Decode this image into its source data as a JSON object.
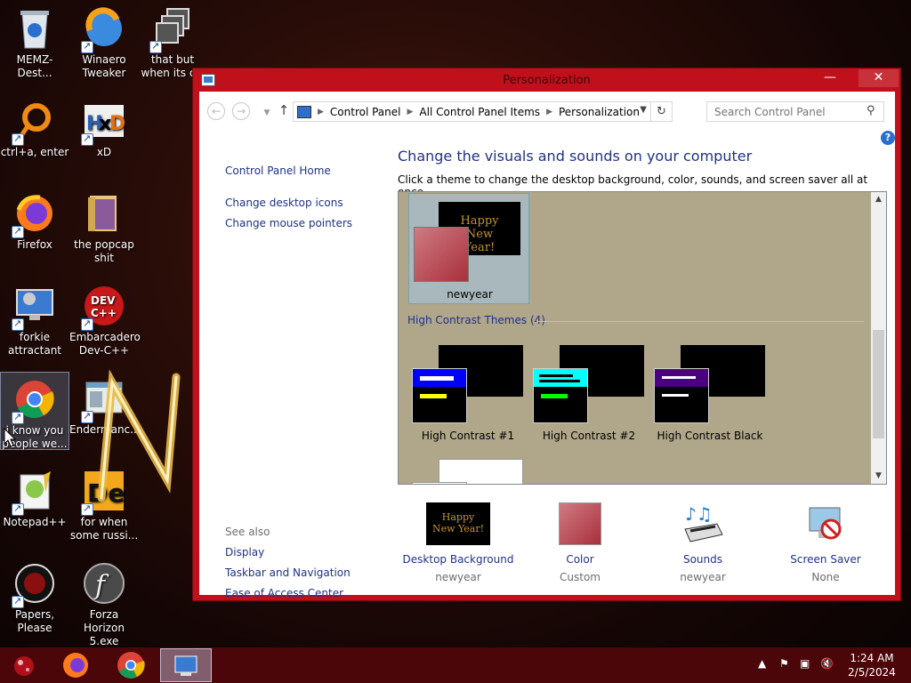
{
  "desktop": {
    "icons": [
      {
        "label": "MEMZ-Dest..."
      },
      {
        "label": "Winaero Tweaker"
      },
      {
        "label": "that but when its c#"
      },
      {
        "label": "ctrl+a, enter"
      },
      {
        "label": "xD"
      },
      {
        "label": "Firefox"
      },
      {
        "label": "the popcap shit"
      },
      {
        "label": "forkie attractant"
      },
      {
        "label": "Embarcadero Dev-C++"
      },
      {
        "label": "i know you people we..."
      },
      {
        "label": "Endermanc..."
      },
      {
        "label": "Notepad++"
      },
      {
        "label": "for when some russi..."
      },
      {
        "label": "Papers, Please"
      },
      {
        "label": "Forza Horizon 5.exe"
      }
    ]
  },
  "window": {
    "title": "Personalization",
    "minimize": "—",
    "maximize": "☐",
    "close": "✕",
    "address": {
      "segments": [
        "Control Panel",
        "All Control Panel Items",
        "Personalization"
      ]
    },
    "search_placeholder": "Search Control Panel",
    "left_pane": {
      "home": "Control Panel Home",
      "links": [
        "Change desktop icons",
        "Change mouse pointers"
      ],
      "see_also": "See also",
      "see_also_links": [
        "Display",
        "Taskbar and Navigation",
        "Ease of Access Center"
      ]
    },
    "heading": "Change the visuals and sounds on your computer",
    "subheading": "Click a theme to change the desktop background, color, sounds, and screen saver all at once.",
    "themes": {
      "selected": {
        "name": "newyear",
        "preview_text": "Happy New Year!"
      },
      "group_header": "High Contrast Themes (4)",
      "high_contrast": [
        {
          "name": "High Contrast #1",
          "colors": {
            "title": "#0000ff",
            "line1": "#ffffff",
            "line2": "#ffff00"
          }
        },
        {
          "name": "High Contrast #2",
          "colors": {
            "title": "#00ffff",
            "line1": "#000000",
            "line2": "#00ff00"
          }
        },
        {
          "name": "High Contrast Black",
          "colors": {
            "title": "#4b0082",
            "line1": "#ffffff",
            "line2": "#ffffff"
          }
        }
      ]
    },
    "bottom": [
      {
        "label": "Desktop Background",
        "value": "newyear"
      },
      {
        "label": "Color",
        "value": "Custom"
      },
      {
        "label": "Sounds",
        "value": "newyear"
      },
      {
        "label": "Screen Saver",
        "value": "None"
      }
    ]
  },
  "taskbar": {
    "time": "1:24 AM",
    "date": "2/5/2024"
  },
  "colors": {
    "window_border": "#c0101c",
    "link": "#1e3287",
    "theme_bg": "#b0a689",
    "taskbar": "#4a0608"
  }
}
